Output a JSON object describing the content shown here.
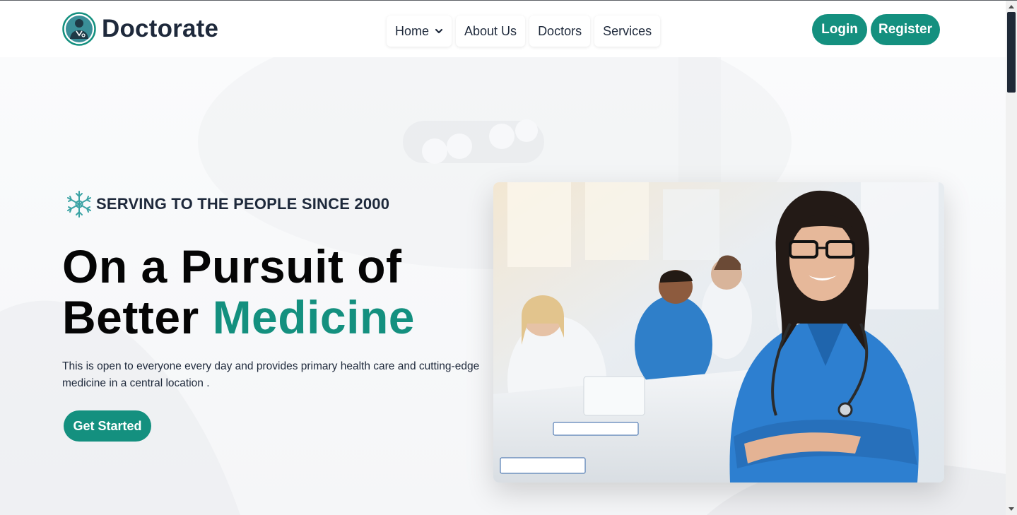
{
  "brand": {
    "name": "Doctorate",
    "icon": "doctor-logo-icon",
    "accent_color": "#14907f"
  },
  "nav": {
    "items": [
      {
        "label": "Home",
        "has_dropdown": true
      },
      {
        "label": "About Us"
      },
      {
        "label": "Doctors"
      },
      {
        "label": "Services"
      }
    ]
  },
  "auth": {
    "login_label": "Login",
    "register_label": "Register"
  },
  "hero": {
    "tagline": "SERVING TO THE PEOPLE SINCE 2000",
    "tagline_icon": "snowflake-icon",
    "headline_line1": "On a Pursuit of",
    "headline_line2_prefix": "Better ",
    "headline_line2_accent": "Medicine",
    "description": "This is open to everyone every day and provides primary health care and cutting-edge medicine in a central location .",
    "cta_label": "Get Started",
    "image": "doctors-team-photo"
  },
  "colors": {
    "primary": "#14907f",
    "heading": "#050505",
    "text": "#1e293b"
  }
}
